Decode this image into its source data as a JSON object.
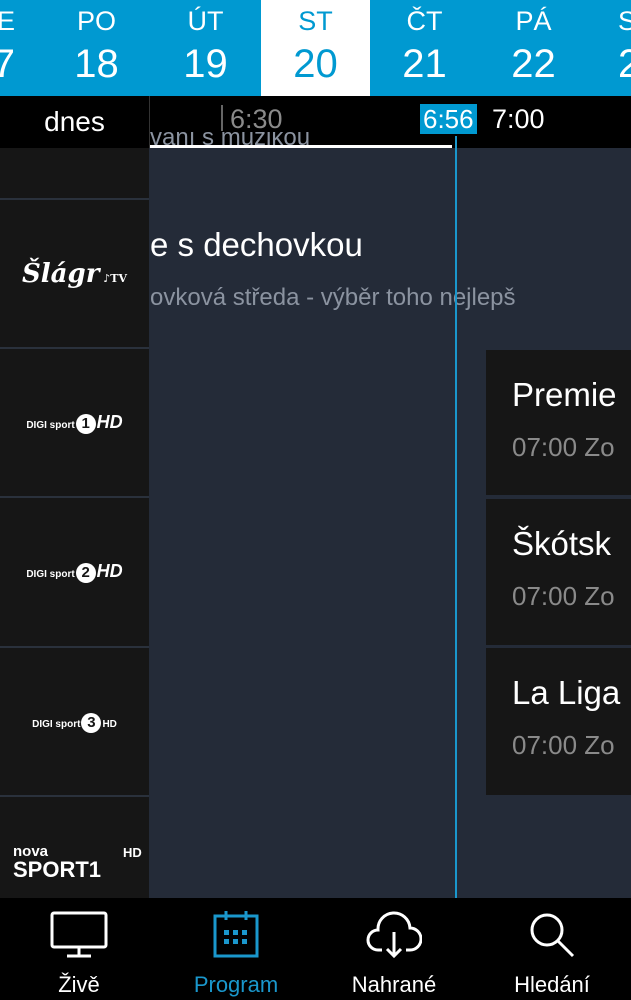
{
  "colors": {
    "accent": "#0099d1",
    "background": "#242b38",
    "channel_bg": "#161616"
  },
  "dates": [
    {
      "day": "E",
      "date": "7"
    },
    {
      "day": "PO",
      "date": "18"
    },
    {
      "day": "ÚT",
      "date": "19"
    },
    {
      "day": "ST",
      "date": "20",
      "selected": true
    },
    {
      "day": "ČT",
      "date": "21"
    },
    {
      "day": "PÁ",
      "date": "22"
    },
    {
      "day": "S",
      "date": "2"
    }
  ],
  "timebar": {
    "today": "dnes",
    "t1": "6:30",
    "now": "6:56",
    "t2": "7:00"
  },
  "channels": [
    {
      "logo": "Šlágr TV"
    },
    {
      "logo": "DIGI sport 1 HD",
      "brand": "DIGI sport",
      "num": "1",
      "hd": "HD"
    },
    {
      "logo": "DIGI sport 2 HD",
      "brand": "DIGI sport",
      "num": "2",
      "hd": "HD"
    },
    {
      "logo": "DIGI sport 3 HD",
      "brand": "DIGI sport",
      "num": "3",
      "hd": "HD"
    },
    {
      "logo": "nova SPORT1 HD",
      "brand": "nova",
      "name": "SPORT1",
      "hd": "HD"
    }
  ],
  "programs": {
    "top_partial": "vání s muzikou",
    "slagr": {
      "title": "e s dechovkou",
      "desc": "ovková středa - výběr toho nejlepš"
    },
    "cards": [
      {
        "title": "Premie",
        "sub": "07:00 Zo"
      },
      {
        "title": "Škótsk",
        "sub": "07:00 Zo"
      },
      {
        "title": "La Liga",
        "sub": "07:00 Zo"
      }
    ]
  },
  "nav": [
    {
      "label": "Živě",
      "icon": "tv-icon"
    },
    {
      "label": "Program",
      "icon": "calendar-icon",
      "active": true
    },
    {
      "label": "Nahrané",
      "icon": "cloud-download-icon"
    },
    {
      "label": "Hledání",
      "icon": "search-icon"
    }
  ]
}
